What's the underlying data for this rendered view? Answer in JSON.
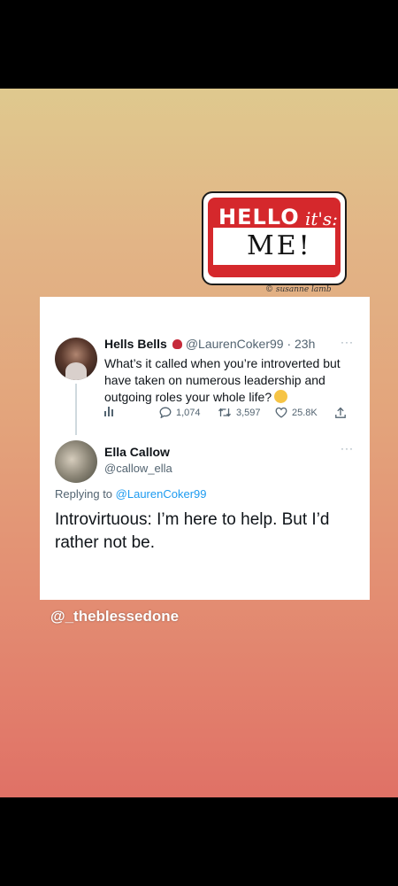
{
  "sticker": {
    "hello": "HELLO",
    "its": "it's:",
    "name": "ME!",
    "credit": "© susanne lamb"
  },
  "tweet": {
    "name": "Hells Bells",
    "handle": "@LaurenCoker99 · 23h",
    "more": "···",
    "text": "What’s it called when you’re introverted but have taken on numerous leadership and outgoing roles your whole life?",
    "replies": "1,074",
    "retweets": "3,597",
    "likes": "25.8K"
  },
  "reply": {
    "name": "Ella Callow",
    "handle": "@callow_ella",
    "more": "···",
    "replying_prefix": "Replying to",
    "replying_handle": "@LaurenCoker99",
    "text": "Introvirtuous: I’m here to help. But I’d rather not be."
  },
  "watermark": "@_theblessedone",
  "icons": [
    "rose-icon",
    "laughing-emoji-icon",
    "stats-icon",
    "reply-icon",
    "retweet-icon",
    "like-icon",
    "share-icon"
  ],
  "colors": {
    "link": "#1d9bf0",
    "sticker_red": "#d5282c"
  }
}
